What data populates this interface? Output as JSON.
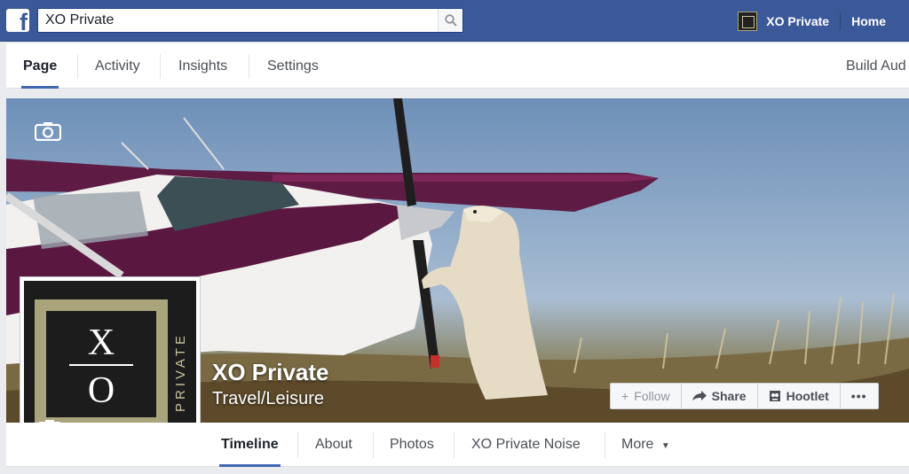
{
  "topbar": {
    "brand_icon": "facebook-f-icon",
    "search_value": "XO Private",
    "account_name": "XO Private",
    "home_label": "Home"
  },
  "admin_tabs": [
    "Page",
    "Activity",
    "Insights",
    "Settings",
    "Build Aud"
  ],
  "page": {
    "name": "XO Private",
    "category": "Travel/Leisure",
    "logo_text": {
      "x": "X",
      "o": "O",
      "private": "PRIVATE"
    }
  },
  "actions": {
    "follow": "Follow",
    "share": "Share",
    "hootlet": "Hootlet",
    "more": "•••"
  },
  "page_tabs": [
    "Timeline",
    "About",
    "Photos",
    "XO Private Noise",
    "More"
  ],
  "colors": {
    "facebook_blue": "#3b5998",
    "tab_active": "#4267b2",
    "logo_frame": "#a9a47c"
  }
}
